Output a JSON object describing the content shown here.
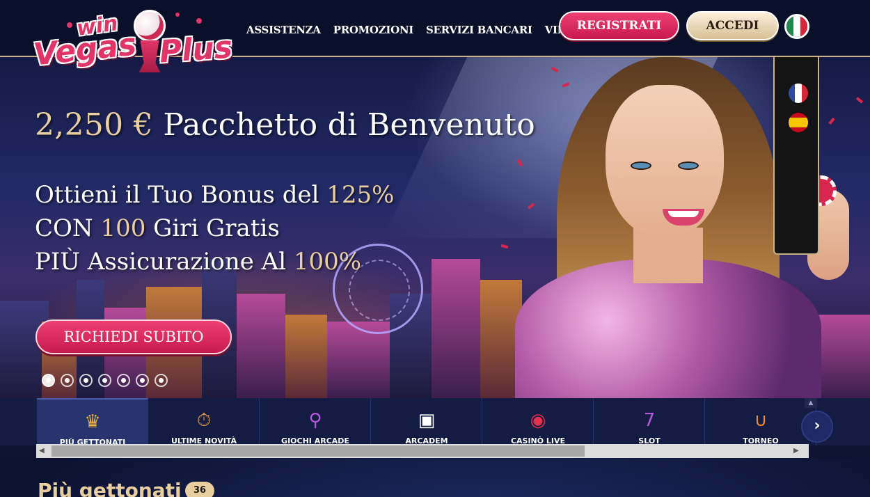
{
  "header": {
    "logo": {
      "top": "win",
      "left": "Vegas",
      "right": "Plus"
    },
    "nav": [
      {
        "label": "ASSISTENZA"
      },
      {
        "label": "PROMOZIONI"
      },
      {
        "label": "SERVIZI BANCARI"
      },
      {
        "label": "VIP"
      }
    ],
    "register_label": "REGISTRATI",
    "login_label": "ACCEDI",
    "language_icon": "italy-flag-icon"
  },
  "hero": {
    "title_amount": "2,250 €",
    "title_text": "Pacchetto di Benvenuto",
    "line1_text": "Ottieni il Tuo Bonus del ",
    "line1_value": "125%",
    "line2_prefix": "CON ",
    "line2_value": "100",
    "line2_text": " Giri Gratis",
    "line3_text": "PIÙ Assicurazione Al ",
    "line3_value": "100%",
    "cta_label": "RICHIEDI SUBITO",
    "slide_count": 7,
    "active_slide": 1
  },
  "language_menu": {
    "options": [
      {
        "name": "france-flag-icon",
        "colors": [
          "#2b4aa0",
          "#ffffff",
          "#d3283a"
        ]
      },
      {
        "name": "spain-flag-icon",
        "colors": [
          "#c60b1e",
          "#ffc400",
          "#c60b1e"
        ]
      }
    ]
  },
  "categories": [
    {
      "label": "PIÙ GETTONATI",
      "icon": "crown-icon",
      "glyph": "♛",
      "color": "#f2b53a",
      "active": true
    },
    {
      "label": "ULTIME NOVITÀ",
      "icon": "stopwatch-icon",
      "glyph": "⏱",
      "color": "#f2a03a",
      "active": false
    },
    {
      "label": "GIOCHI ARCADE",
      "icon": "joystick-icon",
      "glyph": "⚲",
      "color": "#b75ad8",
      "active": false
    },
    {
      "label": "ARCADEM",
      "icon": "arcade-machine-icon",
      "glyph": "▣",
      "color": "#ffffff",
      "active": false
    },
    {
      "label": "CASINÒ LIVE",
      "icon": "roulette-chip-icon",
      "glyph": "◉",
      "color": "#e5304f",
      "active": false
    },
    {
      "label": "SLOT",
      "icon": "slot-machine-icon",
      "glyph": "7",
      "color": "#b55ad8",
      "active": false
    },
    {
      "label": "TORNEO",
      "icon": "horseshoe-icon",
      "glyph": "∪",
      "color": "#f08a2a",
      "active": false
    }
  ],
  "section": {
    "title": "Più gettonati",
    "count": "36"
  },
  "colors": {
    "accent_pink": "#e13569",
    "gold": "#e9cf9f",
    "navy": "#0b102a"
  }
}
